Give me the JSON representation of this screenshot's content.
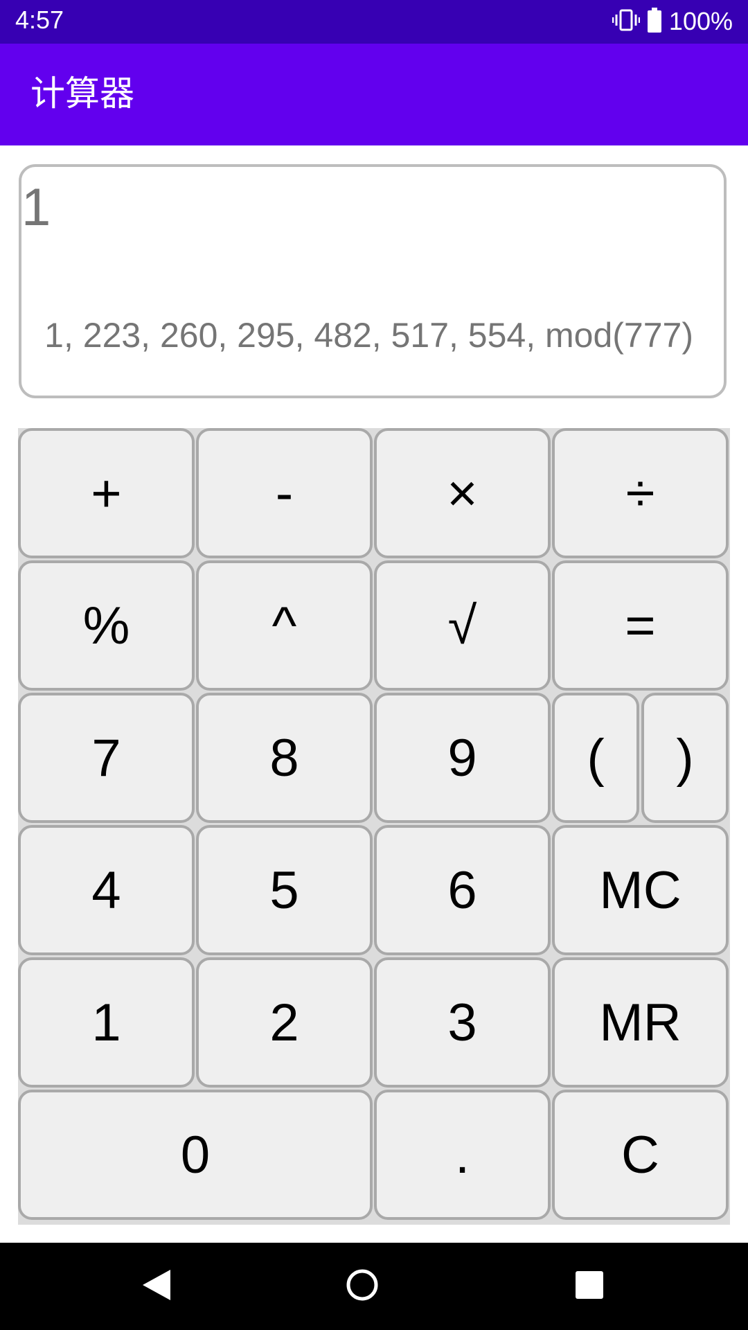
{
  "status_bar": {
    "time": "4:57",
    "battery": "100%",
    "icons": [
      "vibrate-icon",
      "battery-icon"
    ]
  },
  "app_bar": {
    "title": "计算器"
  },
  "display": {
    "expression": "1",
    "history": "1, 223, 260, 295, 482, 517, 554,  mod(777)"
  },
  "keypad": {
    "plus": "+",
    "minus": "-",
    "multiply": "×",
    "divide": "÷",
    "percent": "%",
    "power": "^",
    "sqrt": "√",
    "equals": "=",
    "seven": "7",
    "eight": "8",
    "nine": "9",
    "open_paren": "(",
    "close_paren": ")",
    "four": "4",
    "five": "5",
    "six": "6",
    "memory_clear": "MC",
    "one": "1",
    "two": "2",
    "three": "3",
    "memory_recall": "MR",
    "zero": "0",
    "decimal": ".",
    "clear": "C"
  },
  "nav_bar": {
    "icons": [
      "back-icon",
      "home-icon",
      "recents-icon"
    ]
  },
  "colors": {
    "status_bar": "#3700b3",
    "app_bar": "#6200ee",
    "key_background": "#efefef",
    "key_border": "#a9a9a9",
    "display_text": "#757575"
  }
}
